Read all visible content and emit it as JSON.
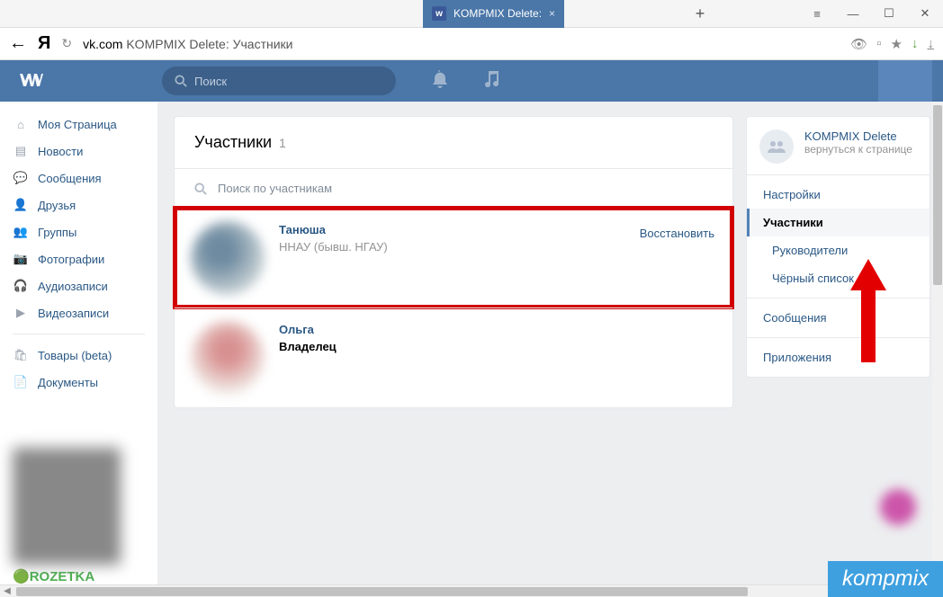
{
  "titlebar": {
    "tab_title": "KOMPMIX Delete:",
    "newtab": "+",
    "menu": "≡",
    "minimize": "—",
    "maximize": "☐",
    "close": "✕"
  },
  "addressbar": {
    "back": "←",
    "browser_logo": "Я",
    "reload": "↻",
    "url_domain": "vk.com",
    "url_rest": " KOMPMIX Delete: Участники",
    "star": "★",
    "download": "↓"
  },
  "vk_header": {
    "logo": "W",
    "search_placeholder": "Поиск"
  },
  "left_nav": [
    {
      "icon": "home",
      "label": "Моя Страница"
    },
    {
      "icon": "news",
      "label": "Новости"
    },
    {
      "icon": "msg",
      "label": "Сообщения"
    },
    {
      "icon": "friends",
      "label": "Друзья"
    },
    {
      "icon": "groups",
      "label": "Группы"
    },
    {
      "icon": "photos",
      "label": "Фотографии"
    },
    {
      "icon": "audio",
      "label": "Аудиозаписи"
    },
    {
      "icon": "video",
      "label": "Видеозаписи"
    }
  ],
  "left_nav2": [
    {
      "icon": "market",
      "label": "Товары (beta)"
    },
    {
      "icon": "docs",
      "label": "Документы"
    }
  ],
  "panel": {
    "title": "Участники",
    "count": "1",
    "search_placeholder": "Поиск по участникам"
  },
  "members": [
    {
      "name": "Танюша",
      "sub": "ННАУ (бывш. НГАУ)",
      "action": "Восстановить",
      "highlighted": true
    },
    {
      "name": "Ольга",
      "sub": "Владелец",
      "owner": true
    }
  ],
  "side": {
    "title": "KOMPMIX Delete",
    "back": "вернуться к странице",
    "items": [
      {
        "label": "Настройки"
      },
      {
        "label": "Участники",
        "active": true
      },
      {
        "label": "Руководители",
        "sub": true
      },
      {
        "label": "Чёрный список",
        "sub": true
      },
      {
        "sep": true
      },
      {
        "label": "Сообщения"
      },
      {
        "sep": true
      },
      {
        "label": "Приложения"
      }
    ]
  },
  "ad": {
    "label": "ROZETKA"
  },
  "watermark": "kompmix"
}
